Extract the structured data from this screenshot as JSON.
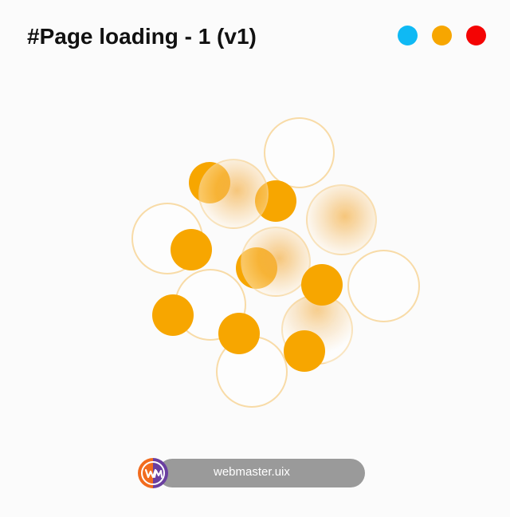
{
  "title": "#Page loading - 1 (v1)",
  "theme_switcher": [
    {
      "name": "blue",
      "color": "#0fb9f4"
    },
    {
      "name": "orange",
      "color": "#f7a600"
    },
    {
      "name": "red",
      "color": "#f40404"
    }
  ],
  "accent_color": "#f7a600",
  "footer": {
    "brand": "webmaster.uix",
    "logo_text": "WM"
  }
}
